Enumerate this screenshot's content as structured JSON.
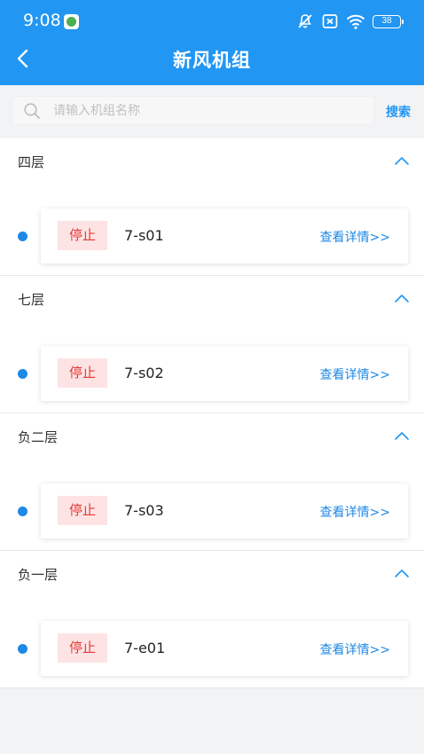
{
  "status_bar": {
    "time": "9:08",
    "battery": "38"
  },
  "header": {
    "title": "新风机组"
  },
  "search": {
    "placeholder": "请输入机组名称",
    "button_label": "搜索"
  },
  "groups": [
    {
      "title": "四层",
      "units": [
        {
          "status": "停止",
          "name": "7-s01",
          "link": "查看详情>>"
        }
      ]
    },
    {
      "title": "七层",
      "units": [
        {
          "status": "停止",
          "name": "7-s02",
          "link": "查看详情>>"
        }
      ]
    },
    {
      "title": "负二层",
      "units": [
        {
          "status": "停止",
          "name": "7-s03",
          "link": "查看详情>>"
        }
      ]
    },
    {
      "title": "负一层",
      "units": [
        {
          "status": "停止",
          "name": "7-e01",
          "link": "查看详情>>"
        }
      ]
    }
  ],
  "colors": {
    "primary": "#2196f3",
    "status_stopped_bg": "#fde3e4",
    "status_stopped_text": "#e53935",
    "dot": "#1e88e5"
  }
}
